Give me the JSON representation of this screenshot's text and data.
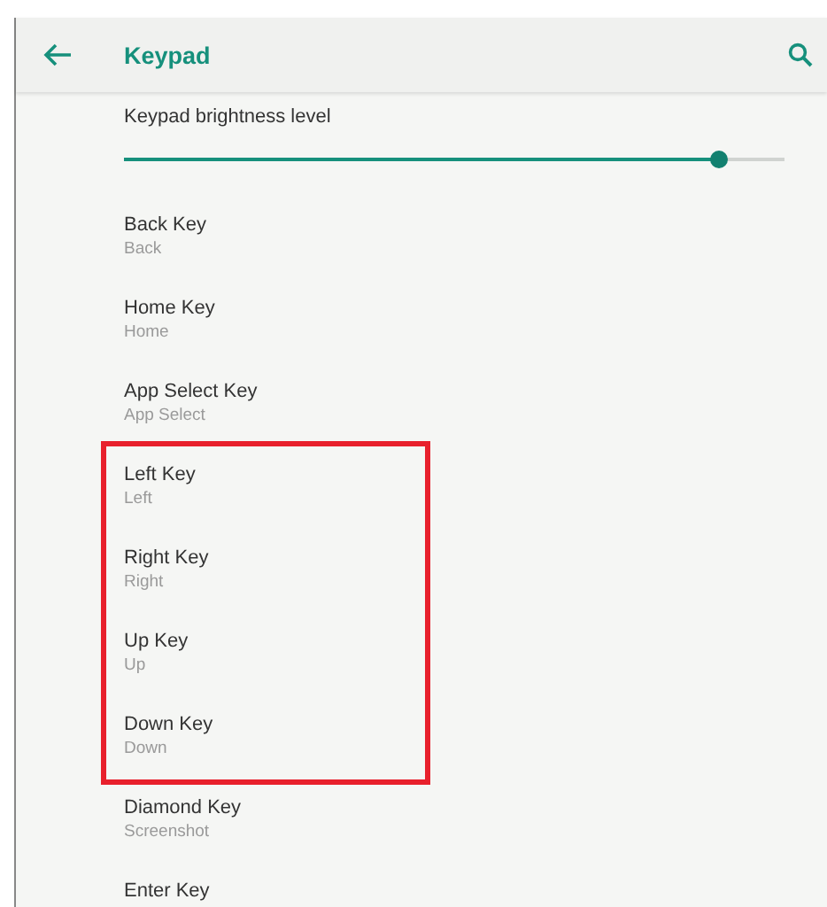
{
  "toolbar": {
    "title": "Keypad"
  },
  "brightness": {
    "label": "Keypad brightness level",
    "level": 0.9
  },
  "sections": [
    {
      "highlighted": false,
      "items": [
        {
          "title": "Back Key",
          "value": "Back"
        },
        {
          "title": "Home Key",
          "value": "Home"
        },
        {
          "title": "App Select Key",
          "value": "App Select"
        }
      ]
    },
    {
      "highlighted": true,
      "items": [
        {
          "title": "Left Key",
          "value": "Left"
        },
        {
          "title": "Right Key",
          "value": "Right"
        },
        {
          "title": "Up Key",
          "value": "Up"
        },
        {
          "title": "Down Key",
          "value": "Down"
        }
      ]
    },
    {
      "highlighted": false,
      "items": [
        {
          "title": "Diamond Key",
          "value": "Screenshot"
        },
        {
          "title": "Enter Key"
        }
      ]
    }
  ]
}
